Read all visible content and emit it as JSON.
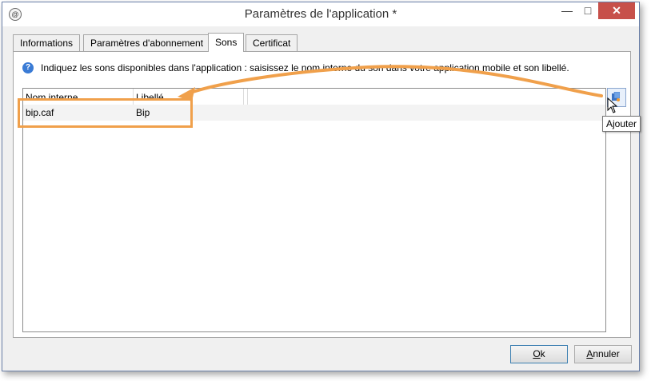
{
  "window": {
    "title": "Paramètres de l'application *",
    "app_icon": "adobe-campaign-icon",
    "titlebar_buttons": {
      "minimize": "—",
      "maximize": "□",
      "close": "✕"
    }
  },
  "tabs": [
    {
      "label": "Informations",
      "active": false
    },
    {
      "label": "Paramètres d'abonnement",
      "active": false
    },
    {
      "label": "Sons",
      "active": true
    },
    {
      "label": "Certificat",
      "active": false
    }
  ],
  "info": {
    "icon": "?",
    "text": "Indiquez les sons disponibles dans l'application : saisissez le nom interne du son dans votre application mobile et son libellé."
  },
  "grid": {
    "columns": [
      "Nom interne",
      "Libellé"
    ],
    "rows": [
      [
        "bip.caf",
        "Bip"
      ]
    ]
  },
  "add_button": {
    "icon": "add-icon",
    "tooltip": "Ajouter"
  },
  "buttons": {
    "ok": {
      "access_key": "O",
      "rest": "k"
    },
    "cancel": {
      "access_key": "A",
      "rest": "nnuler"
    }
  },
  "colors": {
    "highlight": "#f0a04b",
    "close_button": "#c7504a"
  }
}
